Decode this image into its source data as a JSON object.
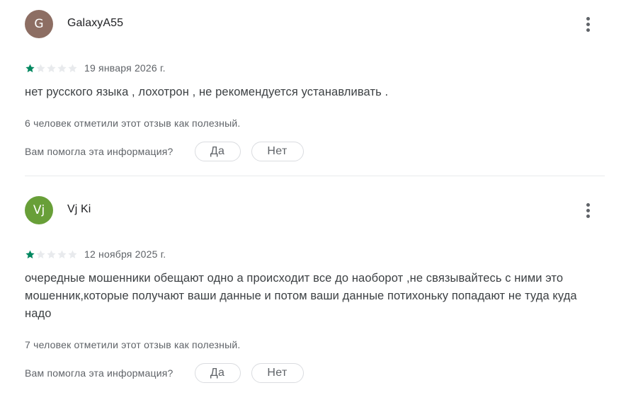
{
  "reviews": [
    {
      "avatar_letter": "G",
      "avatar_color": "#8d6e63",
      "author": "GalaxyA55",
      "rating": 1,
      "max_rating": 5,
      "date": "19 января 2026 г.",
      "text": "нет русского языка , лохотрон , не рекомендуется устанавливать .",
      "helpful_count_text": "6 человек отметили этот отзыв как полезный.",
      "helpful_question": "Вам помогла эта информация?",
      "yes_label": "Да",
      "no_label": "Нет",
      "more_icon": "more-vert-icon"
    },
    {
      "avatar_letter": "Vj",
      "avatar_color": "#689f38",
      "author": "Vj Ki",
      "rating": 1,
      "max_rating": 5,
      "date": "12 ноября 2025 г.",
      "text": "очередные мошенники обещают одно а происходит все до наоборот ,не связывайтесь с ними это мошенник,которые получают ваши данные и потом ваши данные потихоньку попадают не туда куда надо",
      "helpful_count_text": "7 человек отметили этот отзыв как полезный.",
      "helpful_question": "Вам помогла эта информация?",
      "yes_label": "Да",
      "no_label": "Нет",
      "more_icon": "more-vert-icon"
    }
  ],
  "colors": {
    "star_filled": "#01875f",
    "star_empty": "#e8eaed"
  }
}
